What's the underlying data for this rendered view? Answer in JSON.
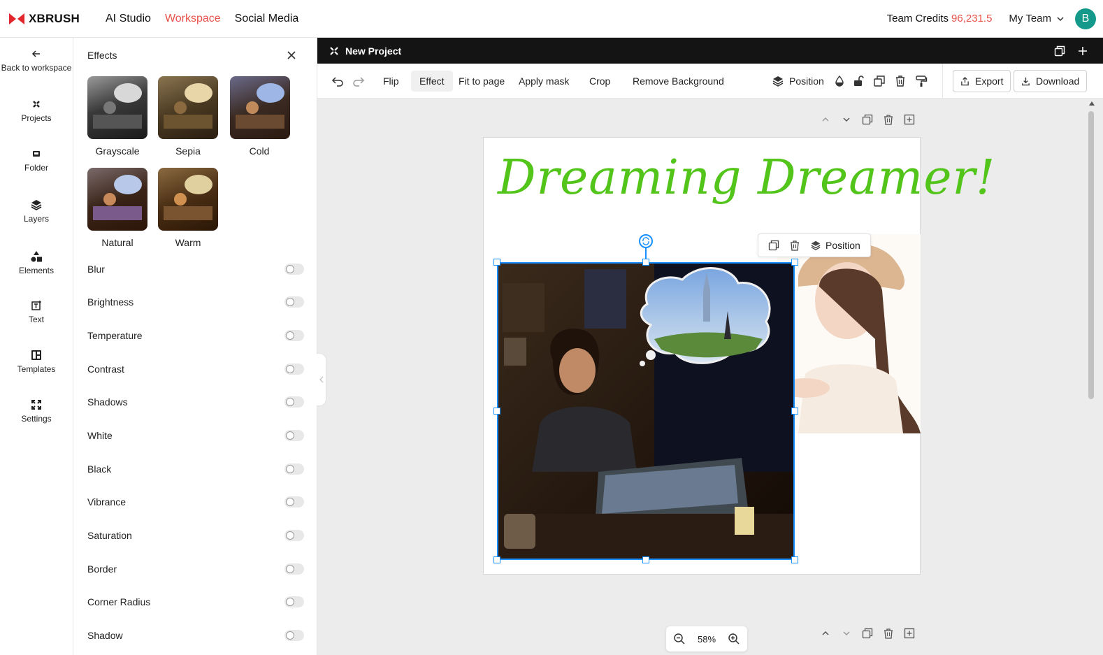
{
  "app": {
    "name": "XBRUSH",
    "nav": [
      "AI Studio",
      "Workspace",
      "Social Media"
    ],
    "active_nav": "Workspace",
    "credits_label": "Team Credits",
    "credits_value": "96,231.5",
    "team_label": "My Team",
    "avatar_letter": "B",
    "accent_color": "#e8524a"
  },
  "rail": {
    "items": [
      {
        "label": "Back to workspace",
        "icon": "arrow-left-icon"
      },
      {
        "label": "Projects",
        "icon": "projects-icon"
      },
      {
        "label": "Folder",
        "icon": "folder-icon"
      },
      {
        "label": "Layers",
        "icon": "layers-icon"
      },
      {
        "label": "Elements",
        "icon": "elements-icon"
      },
      {
        "label": "Text",
        "icon": "text-icon"
      },
      {
        "label": "Templates",
        "icon": "templates-icon"
      },
      {
        "label": "Settings",
        "icon": "settings-icon"
      }
    ]
  },
  "panel": {
    "title": "Effects",
    "presets": [
      "Grayscale",
      "Sepia",
      "Cold",
      "Natural",
      "Warm"
    ],
    "adjustments": [
      "Blur",
      "Brightness",
      "Temperature",
      "Contrast",
      "Shadows",
      "White",
      "Black",
      "Vibrance",
      "Saturation",
      "Border",
      "Corner Radius",
      "Shadow"
    ]
  },
  "project": {
    "title": "New Project"
  },
  "toolbar": {
    "flip": "Flip",
    "effect": "Effect",
    "fit": "Fit to page",
    "mask": "Apply mask",
    "crop": "Crop",
    "remove_bg": "Remove Background",
    "position": "Position",
    "export": "Export",
    "download": "Download"
  },
  "canvas": {
    "headline": "Dreaming Dreamer!",
    "float_position": "Position",
    "zoom": "58%",
    "title_color": "#52c41a",
    "selection_color": "#1890ff"
  }
}
